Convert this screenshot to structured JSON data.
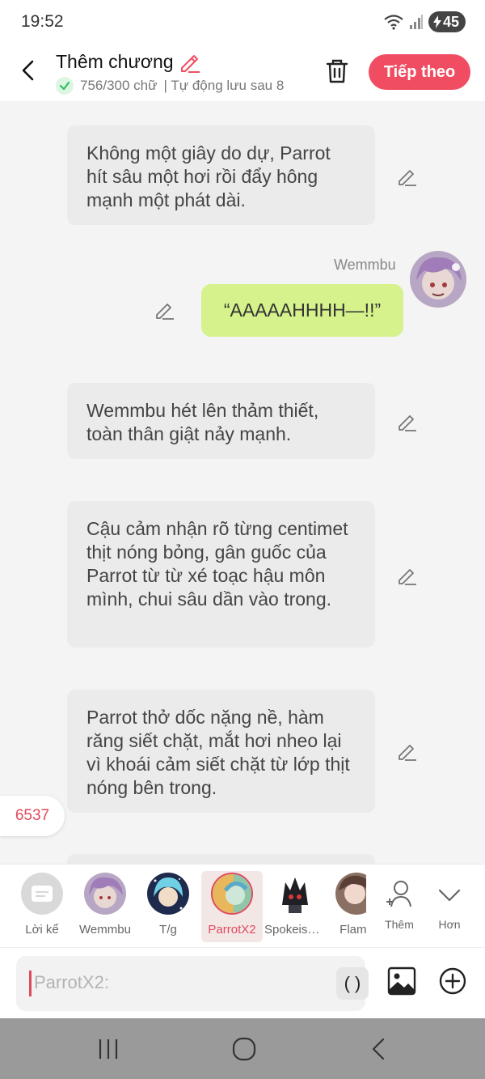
{
  "status_bar": {
    "time": "19:52",
    "battery": "45"
  },
  "header": {
    "title": "Thêm chương",
    "word_count": "756/300 chữ",
    "autosave": "| Tự động lưu sau 8",
    "next_label": "Tiếp theo"
  },
  "messages": [
    {
      "type": "narration",
      "text": "Không một giây do dự, Parrot hít sâu một hơi rồi đẩy hông mạnh một phát dài."
    },
    {
      "type": "speech",
      "speaker": "Wemmbu",
      "text": "“AAAAAHHHH—!!”"
    },
    {
      "type": "narration",
      "text": "Wemmbu hét lên thảm thiết, toàn thân giật nảy mạnh."
    },
    {
      "type": "narration",
      "text": "Cậu cảm nhận rõ từng centimet thịt nóng bỏng, gân guốc của Parrot từ từ xé toạc hậu môn mình, chui sâu dần vào trong."
    },
    {
      "type": "narration",
      "text": "Parrot thở dốc nặng nề, hàm răng siết chặt, mắt hơi nheo lại vì khoái cảm siết chặt từ lớp thịt nóng bên trong."
    }
  ],
  "count_badge": "6537",
  "characters": [
    {
      "name": "Lời kể",
      "icon": "narrator-icon"
    },
    {
      "name": "Wemmbu",
      "icon": "avatar"
    },
    {
      "name": "T/g",
      "icon": "avatar"
    },
    {
      "name": "ParrotX2",
      "icon": "avatar",
      "selected": true
    },
    {
      "name": "SpokeisH...",
      "icon": "avatar"
    },
    {
      "name": "Flame",
      "icon": "avatar"
    }
  ],
  "char_actions": {
    "more_label": "Thêm",
    "expand_label": "Hơn"
  },
  "input": {
    "text": "ParrotX2:",
    "paren_label": "( )"
  },
  "colors": {
    "accent": "#f04d62",
    "speech_bubble": "#d5f28c",
    "narration_bubble": "#ebebeb",
    "done_check": "#2fbf5f"
  }
}
